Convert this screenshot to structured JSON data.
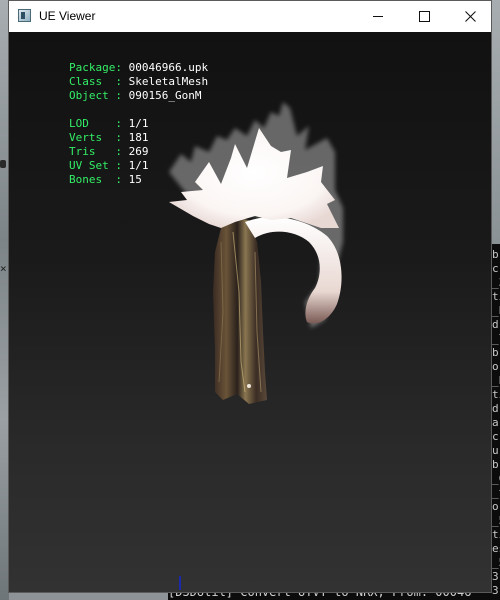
{
  "window": {
    "title": "UE Viewer",
    "controls": {
      "minimize": "minimize",
      "maximize": "maximize",
      "close": "close"
    }
  },
  "info": {
    "package_label": "Package:",
    "package_value": "00046966.upk",
    "class_label": "Class  :",
    "class_value": "SkeletalMesh",
    "object_label": "Object :",
    "object_value": "090156_GonM",
    "lod_label": "LOD    :",
    "lod_value": "1/1",
    "verts_label": "Verts  :",
    "verts_value": "181",
    "tris_label": "Tris   :",
    "tris_value": "269",
    "uvset_label": "UV Set :",
    "uvset_value": "1/1",
    "bones_label": "Bones  :",
    "bones_value": "15"
  },
  "console": {
    "right_edge_chars": [
      "b",
      "c",
      "_3",
      "ti",
      "_b",
      "d",
      "_7",
      "b",
      "o",
      "_b",
      "ti",
      "d",
      "a",
      "c",
      "u",
      "b",
      "_C",
      "_t",
      "o",
      "_5",
      "ti",
      "es",
      "_5",
      "3",
      "3",
      "a",
      "C"
    ],
    "bottom_line": "[D3DUtil] Convert UYVY to NRX; From: 00046"
  },
  "colors": {
    "label_green": "#33ee66",
    "value_white": "#ffffff",
    "viewport_bg": "#1d1d1d",
    "titlebar_bg": "#ffffff"
  },
  "icons": {
    "app": "ue-viewer-app-icon",
    "minimize": "minimize-icon",
    "maximize": "maximize-icon",
    "close": "close-icon"
  }
}
